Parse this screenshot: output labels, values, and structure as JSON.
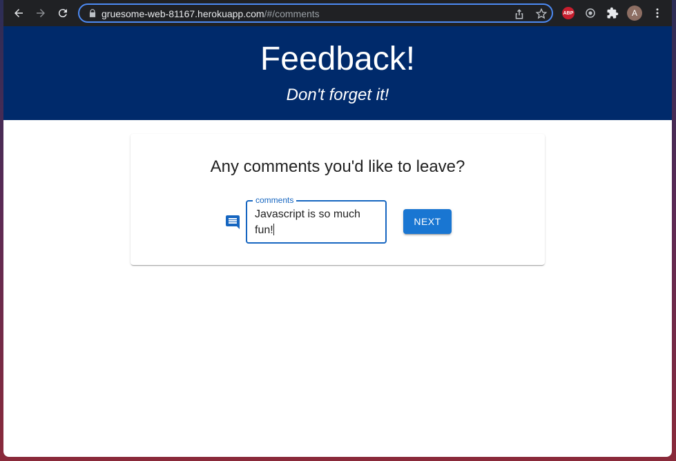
{
  "browser": {
    "url_host": "gruesome-web-81167.herokuapp.com",
    "url_path": "/#/comments",
    "profile_initial": "A",
    "abp_label": "ABP",
    "icons": [
      "back-icon",
      "forward-icon",
      "reload-icon",
      "lock-icon",
      "share-icon",
      "star-icon",
      "adblock-icon",
      "extension-icon",
      "puzzle-icon",
      "menu-icon"
    ]
  },
  "header": {
    "title": "Feedback!",
    "subtitle": "Don't forget it!",
    "background_color": "#002a6b"
  },
  "card": {
    "question": "Any comments you'd like to leave?",
    "comments_field": {
      "label": "comments",
      "value": "Javascript is so much fun!"
    },
    "next_label": "NEXT",
    "accent_color": "#1976d2"
  }
}
